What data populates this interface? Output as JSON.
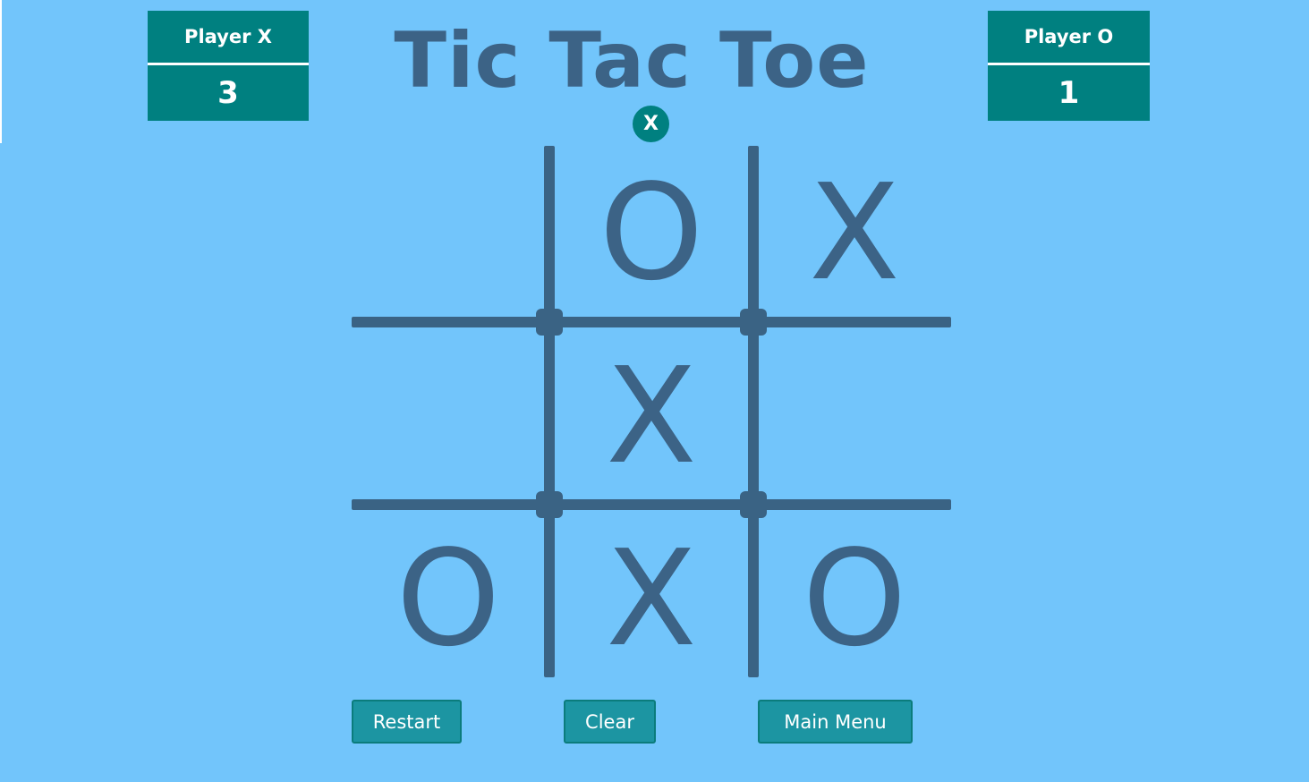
{
  "title": "Tic Tac Toe",
  "current_turn": "X",
  "players": {
    "x": {
      "name": "Player X",
      "score": "3"
    },
    "o": {
      "name": "Player O",
      "score": "1"
    }
  },
  "board": [
    [
      "",
      "O",
      "X"
    ],
    [
      "",
      "X",
      ""
    ],
    [
      "O",
      "X",
      "O"
    ]
  ],
  "buttons": {
    "restart": "Restart",
    "clear": "Clear",
    "main_menu": "Main Menu"
  },
  "colors": {
    "background": "#72c5fb",
    "panel": "#008080",
    "grid": "#3a6384",
    "mark": "#3c6386",
    "button": "#1c95a2"
  }
}
